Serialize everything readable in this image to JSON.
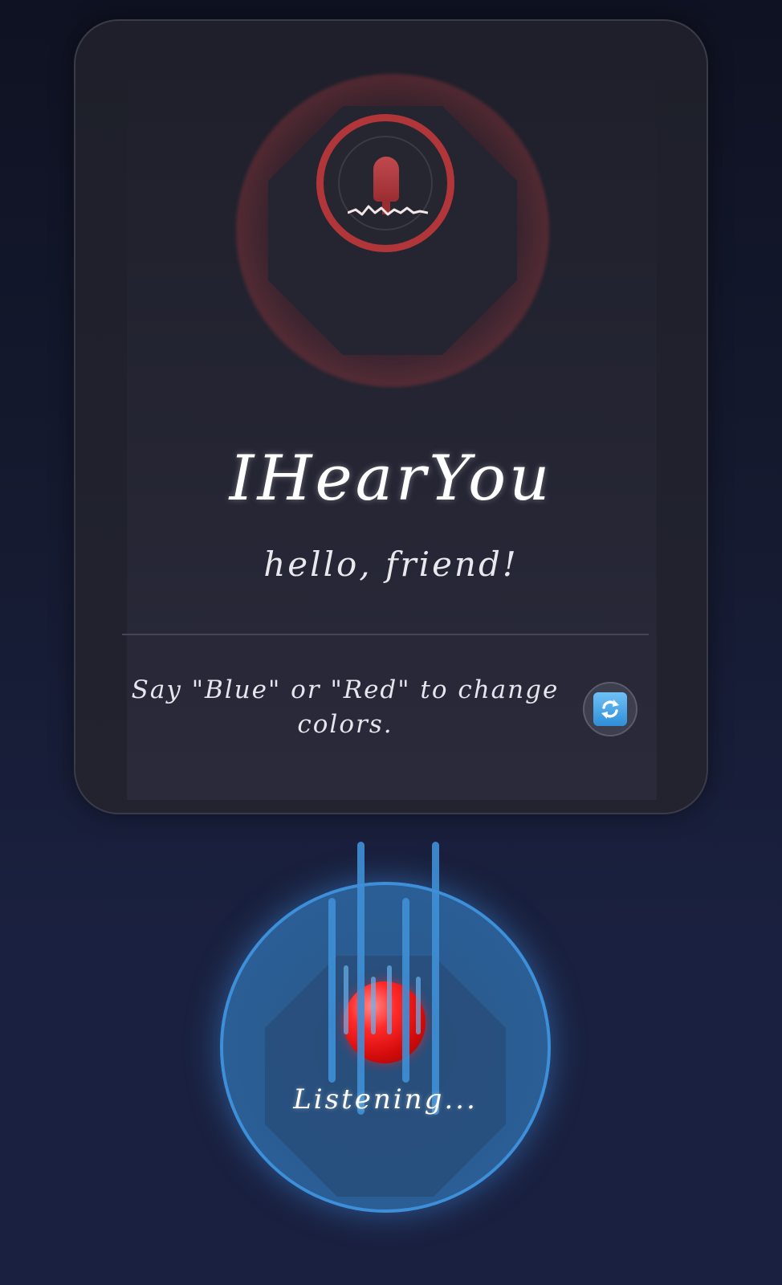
{
  "app": {
    "title": "IHearYou",
    "greeting": "hello, friend!",
    "hint": "Say \"Blue\" or \"Red\" to change colors.",
    "refresh_icon": "refresh-icon"
  },
  "listen": {
    "status": "Listening...",
    "icon": "record-dot"
  },
  "colors": {
    "accent_red": "#b0363a",
    "accent_blue": "#3c8fd8",
    "record_red": "#ff2a2a"
  }
}
